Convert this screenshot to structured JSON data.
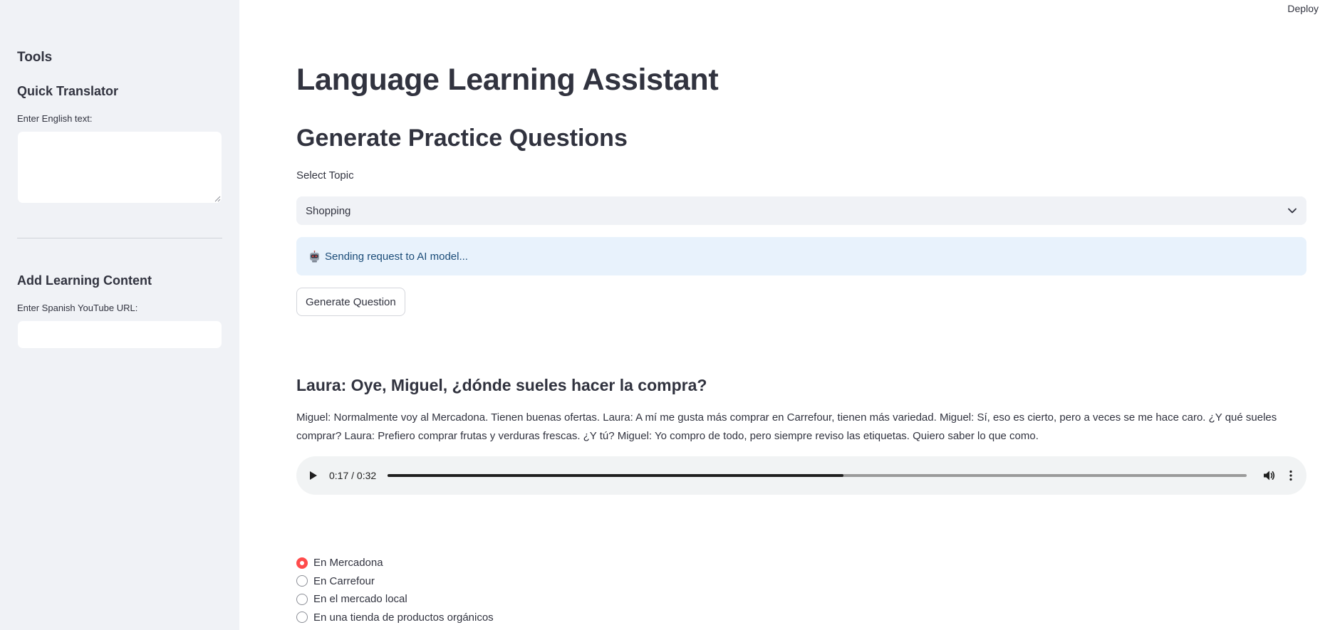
{
  "header": {
    "deploy_label": "Deploy"
  },
  "sidebar": {
    "title": "Tools",
    "translator": {
      "heading": "Quick Translator",
      "label": "Enter English text:",
      "value": ""
    },
    "content": {
      "heading": "Add Learning Content",
      "label": "Enter Spanish YouTube URL:",
      "value": ""
    }
  },
  "main": {
    "title": "Language Learning Assistant",
    "section_title": "Generate Practice Questions",
    "topic": {
      "label": "Select Topic",
      "selected": "Shopping"
    },
    "info_message": "Sending request to AI model...",
    "generate_button": "Generate Question",
    "question": {
      "title": "Laura: Oye, Miguel, ¿dónde sueles hacer la compra?",
      "body": "Miguel: Normalmente voy al Mercadona. Tienen buenas ofertas. Laura: A mí me gusta más comprar en Carrefour, tienen más variedad. Miguel: Sí, eso es cierto, pero a veces se me hace caro. ¿Y qué sueles comprar? Laura: Prefiero comprar frutas y verduras frescas. ¿Y tú? Miguel: Yo compro de todo, pero siempre reviso las etiquetas. Quiero saber lo que como."
    },
    "audio": {
      "time_display": "0:17 / 0:32",
      "progress_fraction": 0.531
    },
    "options": [
      {
        "label": "En Mercadona",
        "selected": true
      },
      {
        "label": "En Carrefour",
        "selected": false
      },
      {
        "label": "En el mercado local",
        "selected": false
      },
      {
        "label": "En una tienda de productos orgánicos",
        "selected": false
      }
    ],
    "colors": {
      "accent": "#ff4b4b",
      "info_background": "#e8f2fc",
      "info_text": "#1b4c78",
      "sidebar_background": "#f0f2f6"
    }
  }
}
